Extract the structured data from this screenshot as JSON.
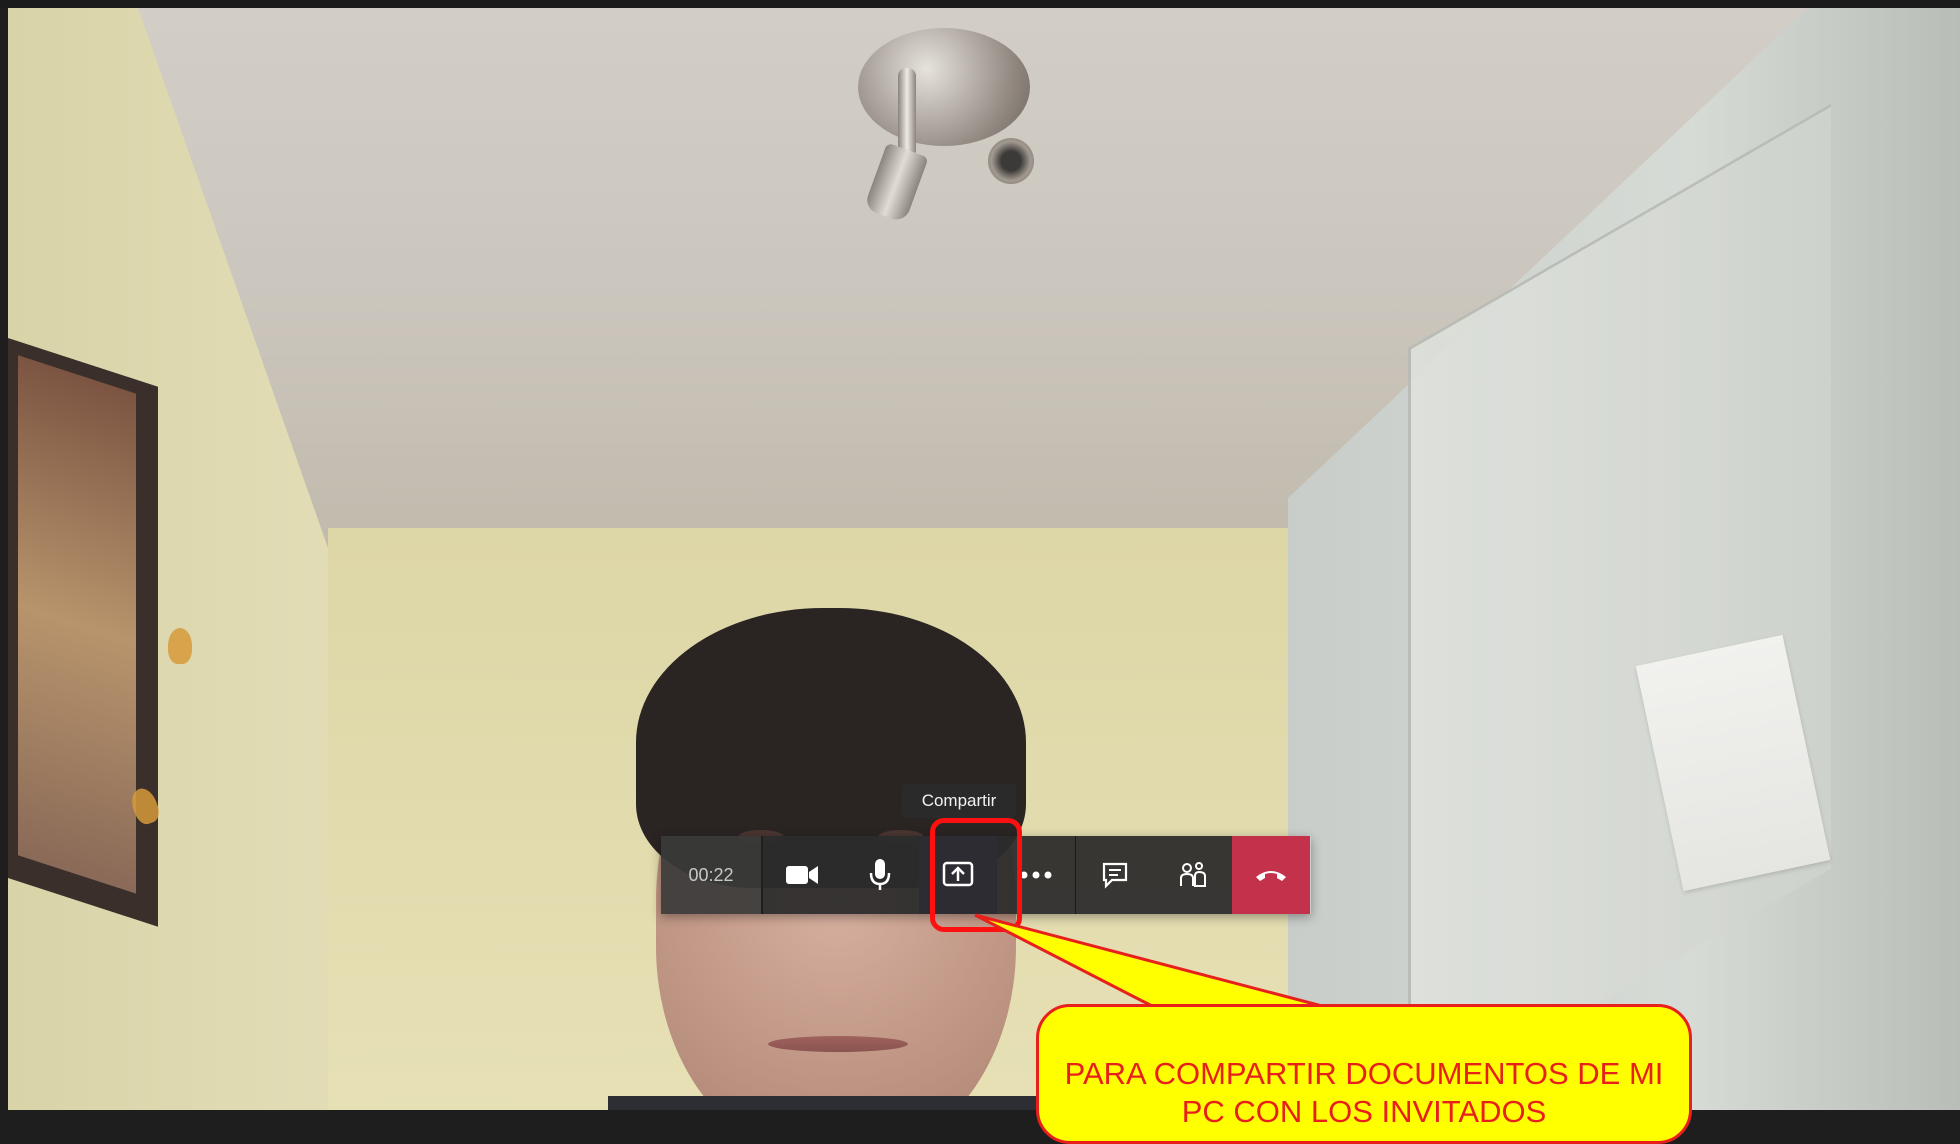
{
  "call": {
    "timer": "00:22",
    "tooltip": "Compartir"
  },
  "toolbar": {
    "buttons": [
      {
        "icon": "video-camera-icon"
      },
      {
        "icon": "microphone-icon"
      },
      {
        "icon": "share-screen-icon"
      },
      {
        "icon": "more-options-icon"
      },
      {
        "icon": "chat-icon"
      },
      {
        "icon": "participants-icon"
      },
      {
        "icon": "hang-up-icon"
      }
    ]
  },
  "annotation": {
    "text": "PARA COMPARTIR DOCUMENTOS DE MI PC CON LOS INVITADOS",
    "fill_color": "#ffff00",
    "border_color": "#e8201b",
    "text_color": "#e8201b"
  },
  "colors": {
    "hangup": "#c4314b",
    "toolbar": "#2c2c2c",
    "highlight": "#ff1010"
  }
}
